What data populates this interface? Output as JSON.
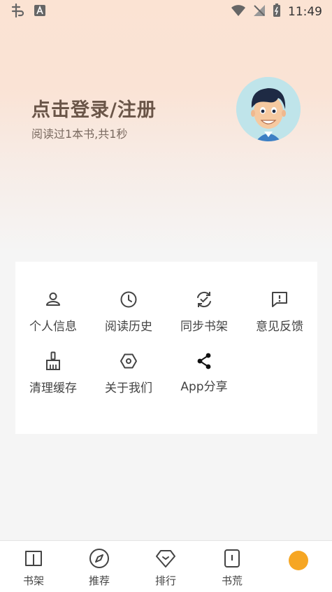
{
  "status_bar": {
    "time": "11:49"
  },
  "profile": {
    "login_title": "点击登录/注册",
    "reading_stats": "阅读过1本书,共1秒"
  },
  "menu": {
    "items": [
      {
        "label": "个人信息",
        "icon": "person-icon"
      },
      {
        "label": "阅读历史",
        "icon": "clock-icon"
      },
      {
        "label": "同步书架",
        "icon": "sync-icon"
      },
      {
        "label": "意见反馈",
        "icon": "feedback-icon"
      },
      {
        "label": "清理缓存",
        "icon": "broom-icon"
      },
      {
        "label": "关于我们",
        "icon": "hexagon-icon"
      },
      {
        "label": "App分享",
        "icon": "share-icon"
      }
    ]
  },
  "bottom_nav": {
    "items": [
      {
        "label": "书架",
        "icon": "bookshelf-icon"
      },
      {
        "label": "推荐",
        "icon": "compass-icon"
      },
      {
        "label": "排行",
        "icon": "ranking-icon"
      },
      {
        "label": "书荒",
        "icon": "book-shortage-icon"
      }
    ]
  },
  "colors": {
    "accent": "#f6a623",
    "title": "#6a5548"
  }
}
